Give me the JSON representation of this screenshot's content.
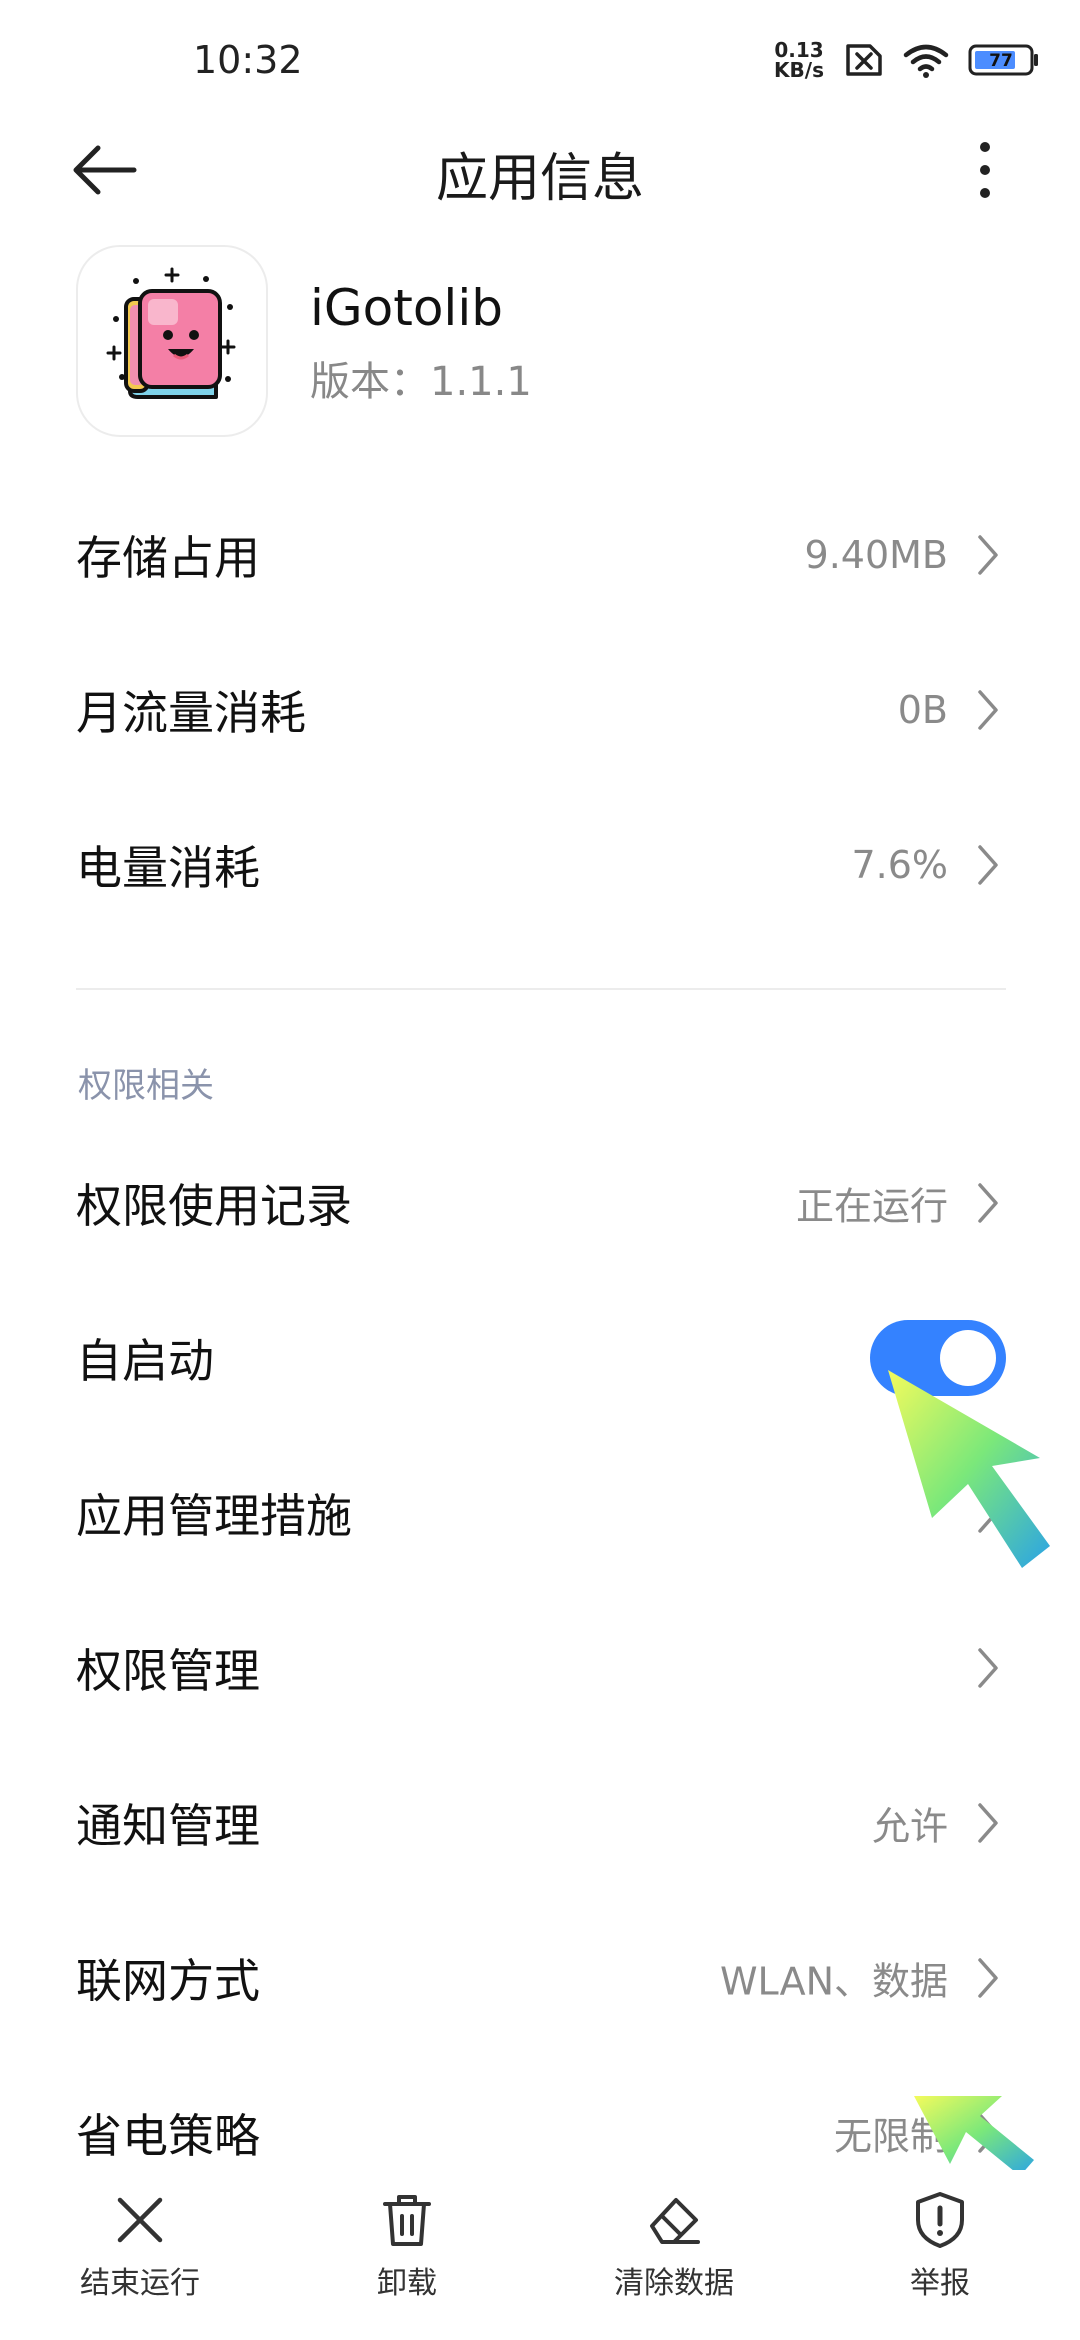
{
  "status_bar": {
    "time": "10:32",
    "net_speed_value": "0.13",
    "net_speed_unit": "KB/s",
    "sim_icon": "no-sim-icon",
    "wifi_icon": "wifi-icon",
    "battery_level": "77"
  },
  "header": {
    "title": "应用信息",
    "back_icon": "back-arrow-icon",
    "more_icon": "more-vertical-icon"
  },
  "app": {
    "name": "iGotolib",
    "version_label": "版本：",
    "version": "1.1.1",
    "icon": "book-face-app-icon"
  },
  "usage_rows": [
    {
      "label": "存储占用",
      "value": "9.40MB"
    },
    {
      "label": "月流量消耗",
      "value": "0B"
    },
    {
      "label": "电量消耗",
      "value": "7.6%"
    }
  ],
  "permissions_section": {
    "title": "权限相关",
    "rows": [
      {
        "label": "权限使用记录",
        "value": "正在运行"
      },
      {
        "label": "自启动",
        "value": ""
      },
      {
        "label": "应用管理措施",
        "value": ""
      },
      {
        "label": "权限管理",
        "value": ""
      },
      {
        "label": "通知管理",
        "value": "允许"
      },
      {
        "label": "联网方式",
        "value": "WLAN、数据"
      },
      {
        "label": "省电策略",
        "value": "无限制"
      }
    ],
    "autostart_enabled": true
  },
  "bottom_bar": {
    "items": [
      {
        "label": "结束运行",
        "icon": "close-icon"
      },
      {
        "label": "卸载",
        "icon": "trash-icon"
      },
      {
        "label": "清除数据",
        "icon": "eraser-icon"
      },
      {
        "label": "举报",
        "icon": "shield-alert-icon"
      }
    ]
  },
  "colors": {
    "accent": "#3482ff",
    "section_header": "#8a93ab",
    "secondary_text": "#8a8a8a"
  }
}
